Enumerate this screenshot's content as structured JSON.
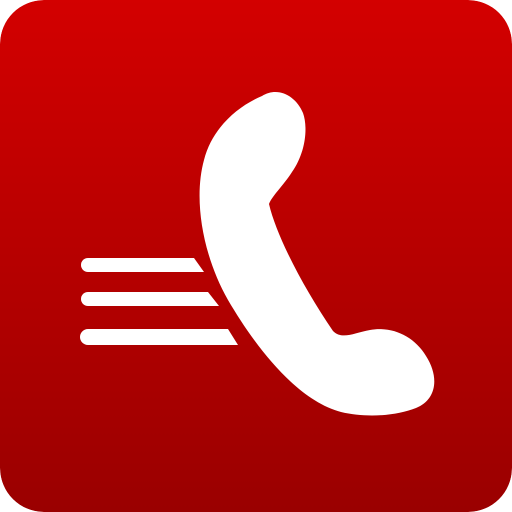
{
  "icon": {
    "name": "phone-call-icon",
    "colors": {
      "gradient_top": "#d30000",
      "gradient_bottom": "#9a0000",
      "glyph": "#ffffff"
    }
  }
}
